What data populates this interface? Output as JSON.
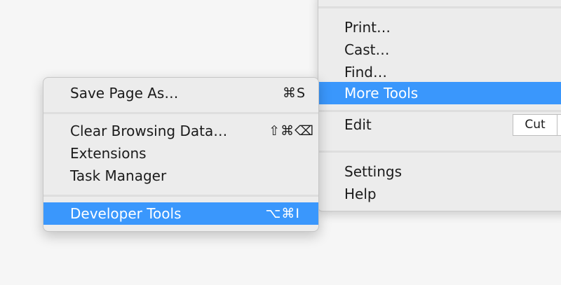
{
  "main_menu": {
    "items": [
      {
        "label": "Print…"
      },
      {
        "label": "Cast…"
      },
      {
        "label": "Find…"
      },
      {
        "label": "More Tools",
        "selected": true
      }
    ],
    "edit": {
      "label": "Edit",
      "cut_label": "Cut"
    },
    "bottom_items": [
      {
        "label": "Settings"
      },
      {
        "label": "Help"
      }
    ],
    "selection_color": "#3a97fc"
  },
  "more_tools_menu": {
    "groups": [
      [
        {
          "label": "Save Page As…",
          "shortcut": "⌘S"
        }
      ],
      [
        {
          "label": "Clear Browsing Data…",
          "shortcut": "⇧⌘⌫"
        },
        {
          "label": "Extensions",
          "shortcut": ""
        },
        {
          "label": "Task Manager",
          "shortcut": ""
        }
      ],
      [
        {
          "label": "Developer Tools",
          "shortcut": "⌥⌘I",
          "selected": true
        }
      ]
    ]
  }
}
